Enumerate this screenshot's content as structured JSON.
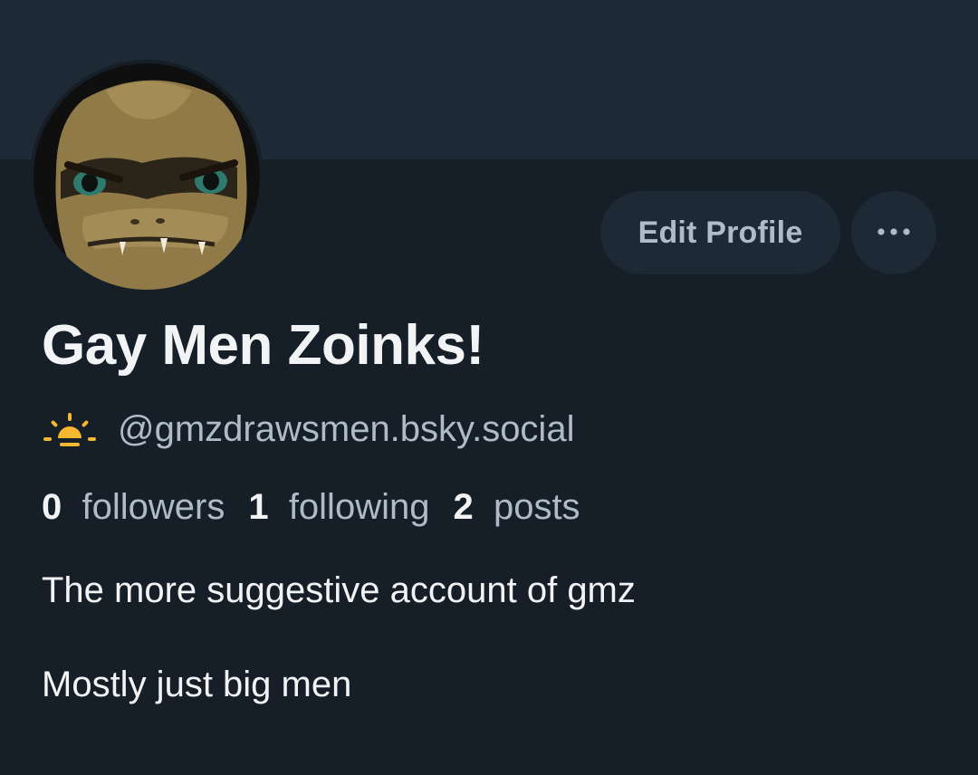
{
  "profile": {
    "display_name": "Gay Men Zoinks!",
    "handle": "@gmzdrawsmen.bsky.social",
    "bio_lines": [
      "The more suggestive account of gmz",
      "Mostly just big men"
    ]
  },
  "stats": {
    "followers_count": "0",
    "followers_label": "followers",
    "following_count": "1",
    "following_label": "following",
    "posts_count": "2",
    "posts_label": "posts"
  },
  "actions": {
    "edit_profile_label": "Edit Profile",
    "more_icon": "ellipsis-icon"
  },
  "icons": {
    "handle_badge": "sunrise-icon",
    "avatar": "crocodile-avatar"
  },
  "colors": {
    "background": "#161e27",
    "banner": "#1e2936",
    "button_bg": "#1e2936",
    "muted_text": "#aebbc9",
    "primary_text": "#f1f3f5",
    "sun": "#f5b82e"
  }
}
